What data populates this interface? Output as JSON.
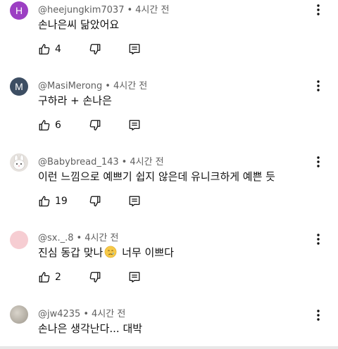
{
  "comments": [
    {
      "avatar_letter": "H",
      "avatar_color": "#9c3fc3",
      "username": "@heejungkim7037",
      "time": "4시간 전",
      "text": "손나은씨 닮았어요",
      "likes": "4"
    },
    {
      "avatar_letter": "M",
      "avatar_color": "#3d4e63",
      "username": "@MasiMerong",
      "time": "4시간 전",
      "text": "구하라 + 손나은",
      "likes": "6"
    },
    {
      "avatar_letter": "",
      "avatar_color": "#e6e2de",
      "username": "@Babybread_143",
      "time": "4시간 전",
      "text": "이런 느낌으로 예쁘기 쉽지 않은데 유니크하게 예쁜 듯",
      "likes": "19"
    },
    {
      "avatar_letter": "",
      "avatar_color": "#f6cdd2",
      "username": "@sx._.8",
      "time": "4시간 전",
      "text_before": "진심 동갑 맞나",
      "text_after": " 너무 이쁘다",
      "emoji": "crying-face-emoji",
      "likes": "2"
    },
    {
      "avatar_letter": "",
      "avatar_color": "#b9b4ab",
      "username": "@jw4235",
      "time": "4시간 전",
      "text": "손나은 생각난다... 대박"
    }
  ],
  "separator": "•"
}
